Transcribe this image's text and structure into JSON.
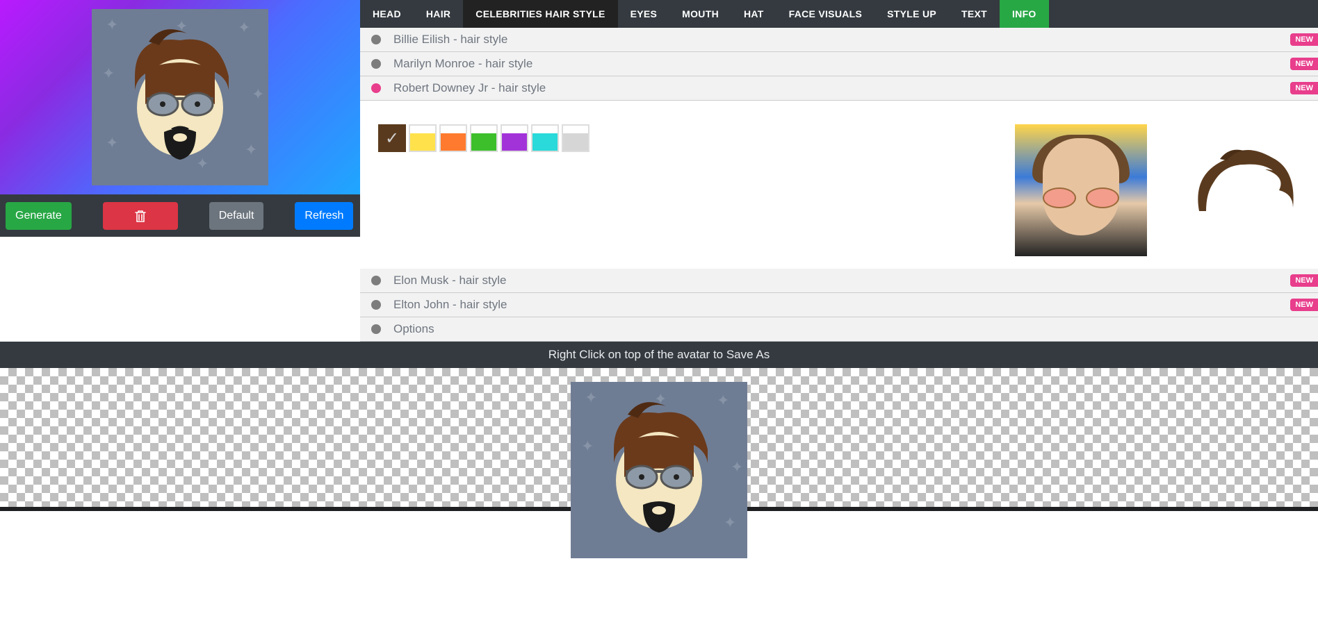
{
  "tabs": {
    "head": "HEAD",
    "hair": "HAIR",
    "celeb": "CELEBRITIES HAIR STYLE",
    "eyes": "EYES",
    "mouth": "MOUTH",
    "hat": "HAT",
    "face": "FACE VISUALS",
    "style": "STYLE UP",
    "text": "TEXT",
    "info": "INFO"
  },
  "actions": {
    "generate": "Generate",
    "default": "Default",
    "refresh": "Refresh"
  },
  "celebs": {
    "billie": {
      "label": "Billie Eilish - hair style",
      "badge": "NEW"
    },
    "marilyn": {
      "label": "Marilyn Monroe - hair style",
      "badge": "NEW"
    },
    "rdj": {
      "label": "Robert Downey Jr - hair style",
      "badge": "NEW"
    },
    "elon": {
      "label": "Elon Musk - hair style",
      "badge": "NEW"
    },
    "elton": {
      "label": "Elton John - hair style",
      "badge": "NEW"
    },
    "options": {
      "label": "Options"
    }
  },
  "swatches": {
    "brown": "#5a3a1e",
    "yellow": "#ffe24b",
    "orange": "#ff7a2e",
    "green": "#3dbf2c",
    "purple": "#a233d9",
    "cyan": "#2ad9d9",
    "gray": "#d6d6d6"
  },
  "save_hint": "Right Click on top of the avatar to Save As",
  "avatar_bg": "#6f7d94"
}
